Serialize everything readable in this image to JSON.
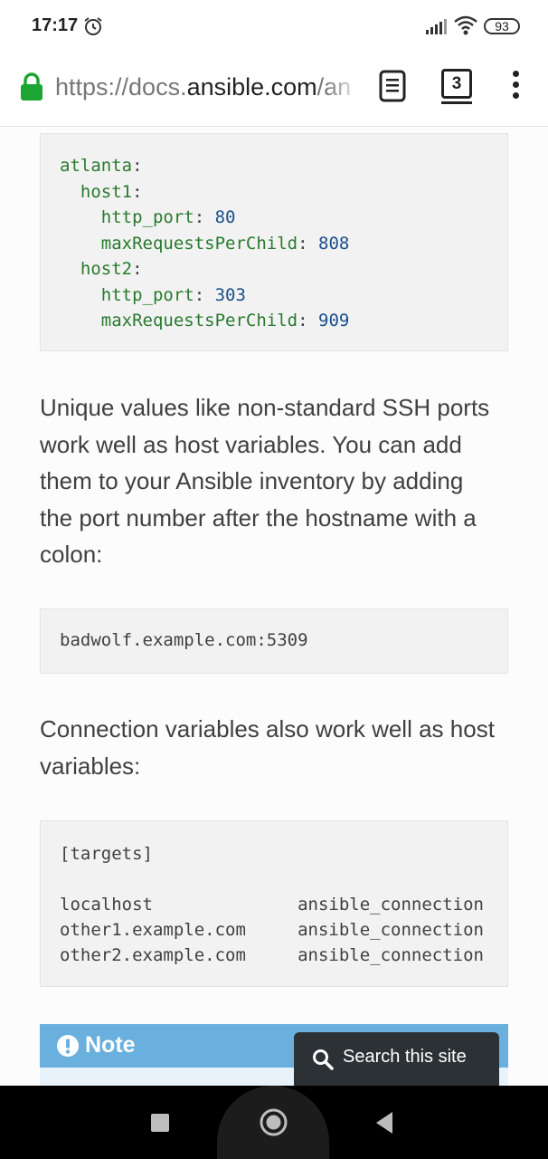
{
  "status_bar": {
    "time": "17:17",
    "battery_level": "93",
    "icons": [
      "alarm-icon",
      "signal-icon",
      "wifi-icon",
      "battery-icon"
    ]
  },
  "browser": {
    "url_scheme": "https://docs.",
    "url_domain": "ansible.com",
    "url_path": "/an",
    "tab_count": "3",
    "icons": [
      "lock-icon",
      "reader-mode-icon",
      "overflow-menu-icon"
    ],
    "accent_color": "#1da533"
  },
  "code_block_1": {
    "lines": [
      {
        "key": "atlanta",
        "sep": ":",
        "value": "",
        "indent": ""
      },
      {
        "key": "host1",
        "sep": ":",
        "value": "",
        "indent": "  "
      },
      {
        "key": "http_port",
        "sep": ": ",
        "value": "80",
        "indent": "    "
      },
      {
        "key": "maxRequestsPerChild",
        "sep": ": ",
        "value": "808",
        "indent": "    "
      },
      {
        "key": "host2",
        "sep": ":",
        "value": "",
        "indent": "  "
      },
      {
        "key": "http_port",
        "sep": ": ",
        "value": "303",
        "indent": "    "
      },
      {
        "key": "maxRequestsPerChild",
        "sep": ": ",
        "value": "909",
        "indent": "    "
      }
    ]
  },
  "paragraph_1": {
    "lines": [
      "Unique values like non-standard SSH ports",
      "work well as host variables. You can add",
      "them to your Ansible inventory by adding",
      "the port number after the hostname with a",
      "colon:"
    ]
  },
  "code_block_2": {
    "lines": [
      "badwolf.example.com:5309"
    ]
  },
  "paragraph_2": {
    "lines": [
      "Connection variables also work well as host",
      "variables:"
    ]
  },
  "code_block_3": {
    "lines": [
      "[targets]",
      "",
      "localhost              ansible_connection",
      "other1.example.com     ansible_connection",
      "other2.example.com     ansible_connection"
    ]
  },
  "note": {
    "title": "Note",
    "color": "#6ab0de"
  },
  "search": {
    "label": "Search this site"
  },
  "nav_bar": {
    "buttons": [
      "recents-button",
      "home-button",
      "back-button"
    ]
  }
}
